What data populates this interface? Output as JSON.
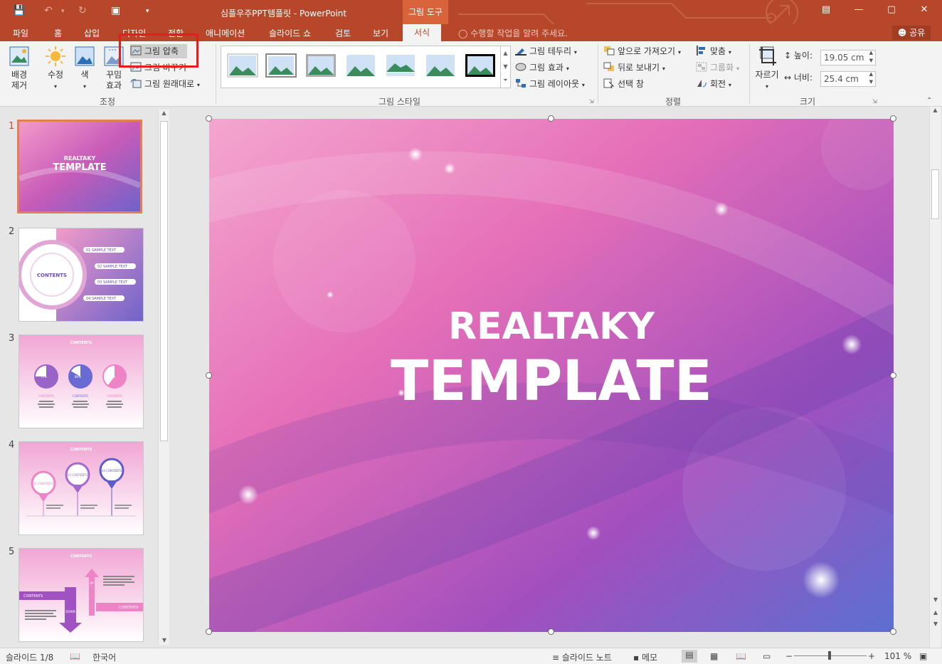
{
  "window": {
    "title": "심플우주PPT템플릿 - PowerPoint",
    "tool_context": "그림 도구"
  },
  "tabs": [
    "파일",
    "홈",
    "삽입",
    "디자인",
    "전환",
    "애니메이션",
    "슬라이드 쇼",
    "검토",
    "보기",
    "서식"
  ],
  "active_tab": "서식",
  "tell_me": "수행할 작업을 알려 주세요.",
  "share": "공유",
  "ribbon": {
    "adjust": {
      "remove_bg": "배경\n제거",
      "corrections": "수정",
      "color": "색",
      "artistic": "꾸밈\n효과",
      "compress": "그림 압축",
      "change": "그림 바꾸기",
      "reset": "그림 원래대로",
      "label": "조정"
    },
    "styles": {
      "border": "그림 테두리",
      "effects": "그림 효과",
      "layout": "그림 레이아웃",
      "label": "그림 스타일"
    },
    "arrange": {
      "forward": "앞으로 가져오기",
      "backward": "뒤로 보내기",
      "selection": "선택 창",
      "align": "맞춤",
      "group": "그룹화",
      "rotate": "회전",
      "label": "정렬"
    },
    "size": {
      "crop": "자르기",
      "height_label": "높이:",
      "height": "19.05 cm",
      "width_label": "너비:",
      "width": "25.4 cm",
      "label": "크기"
    }
  },
  "slides": {
    "numbers": [
      "1",
      "2",
      "3",
      "4",
      "5"
    ],
    "s1_line1": "REALTAKY",
    "s1_line2": "TEMPLATE",
    "s2_center": "CONTENTS",
    "s2_items": [
      "01  SAMPLE TEXT",
      "02  SAMPLE TEXT",
      "03  SAMPLE TEXT",
      "04  SAMPLE TEXT"
    ],
    "s3_title": "CONTENTS",
    "s3_percents": [
      "75%",
      "80%",
      "60%"
    ],
    "s3_labels": [
      "CONTENTS",
      "CONTENTS",
      "CONTENTS"
    ],
    "s3_texts": [
      "You can simply impress your audience and add a unique zing and appeal to your Presentations.",
      "You can simply impress your audience and add a unique zing and appeal to your Presentations.",
      "You can simply impress your audience and add a unique zing and appeal to your Presentations."
    ],
    "s4_title": "CONTENTS",
    "s4_pins": [
      "01\nCONTENTS",
      "02\nCONTENTS",
      "03\nCONTENTS"
    ],
    "s4_texts": [
      "You can simply impress your audience and add a unique zing.",
      "You can simply impress your audience and add a unique zing.",
      "You can simply impress your audience and add a unique zing."
    ],
    "s5_title": "CONTENTS",
    "s5_left": "CONTENTS",
    "s5_right": "CONTENTS",
    "s5_up": "UP",
    "s5_down": "DOWN",
    "s5_text_top": "Everything is meaningful in our lives. The words and the behaviors that we see and hear every day influence our thoughts.",
    "s5_text_bottom": "Everything is meaningful in our lives. The words and the behaviors that we see and hear every day influence our thoughts."
  },
  "main_slide": {
    "line1": "REALTAKY",
    "line2": "TEMPLATE"
  },
  "status": {
    "slide_count": "슬라이드 1/8",
    "language": "한국어",
    "notes": "슬라이드 노트",
    "comments": "메모",
    "zoom": "101 %"
  },
  "colors": {
    "accent": "#b7472a",
    "ribbon_bg": "#f3f3f3",
    "slide_pink": "#f07fc2",
    "slide_purple": "#7b4fc4",
    "highlight": "#e81c1c"
  }
}
